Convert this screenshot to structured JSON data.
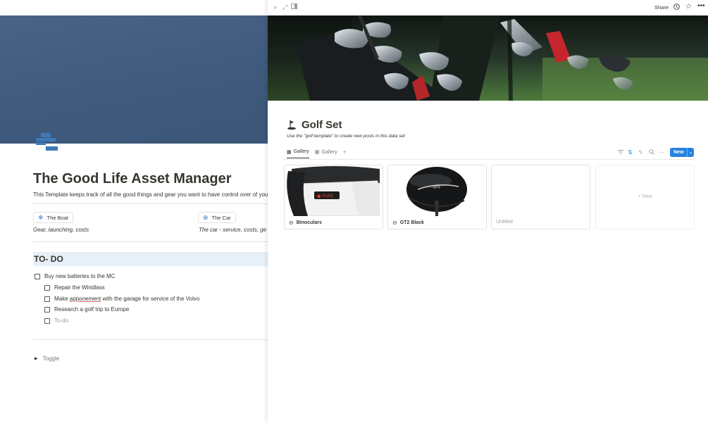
{
  "left_page": {
    "title": "The Good Life Asset Manager",
    "description": "This Template keeps track of all the good things and gear you want to have control over of you",
    "links": [
      {
        "label": "The Boat",
        "icon": "snowflake-icon",
        "subtitle": "Gear, launching, costs"
      },
      {
        "label": "The Car",
        "icon": "globe-icon",
        "subtitle": "The car - service, costs, ge"
      }
    ],
    "todo_heading": "TO- DO",
    "todos": [
      {
        "prefix": "Buy new batteries to the MC",
        "underlined": "",
        "suffix": "",
        "indent": 0
      },
      {
        "prefix": "Repair the Windlass",
        "underlined": "",
        "suffix": "",
        "indent": 1
      },
      {
        "prefix": "Make ",
        "underlined": "apponement",
        "suffix": " with the garage for service of the Volvo",
        "indent": 1
      },
      {
        "prefix": "Research a golf trip to Europe",
        "underlined": "",
        "suffix": "",
        "indent": 1
      },
      {
        "prefix": "To-do",
        "underlined": "",
        "suffix": "",
        "indent": 1,
        "placeholder": true
      }
    ],
    "toggle_label": "Toggle",
    "colors": {
      "cover": "#44607f",
      "heading_bg": "#e7f0f8",
      "icon_blue": "#3e79b8"
    }
  },
  "right_panel": {
    "topbar": {
      "share_label": "Share",
      "icons": [
        "double-chevron-right-icon",
        "expand-icon",
        "side-panel-icon",
        "clock-icon",
        "star-icon",
        "more-icon"
      ]
    },
    "database": {
      "icon": "golf-icon",
      "title": "Golf Set",
      "description": "Use the \"golf template\" to create new posts in this data set",
      "tabs": [
        {
          "label": "Gallery",
          "active": true
        },
        {
          "label": "Gallery",
          "active": false
        }
      ],
      "new_button_label": "New",
      "cards": [
        {
          "title": "Binoculars",
          "image": "rangefinder"
        },
        {
          "title": "GT2 Black",
          "image": "driver"
        },
        {
          "title": "Untitled",
          "image": "none"
        }
      ],
      "new_card_label": "+ New"
    },
    "colors": {
      "accent": "#2383e2"
    }
  }
}
